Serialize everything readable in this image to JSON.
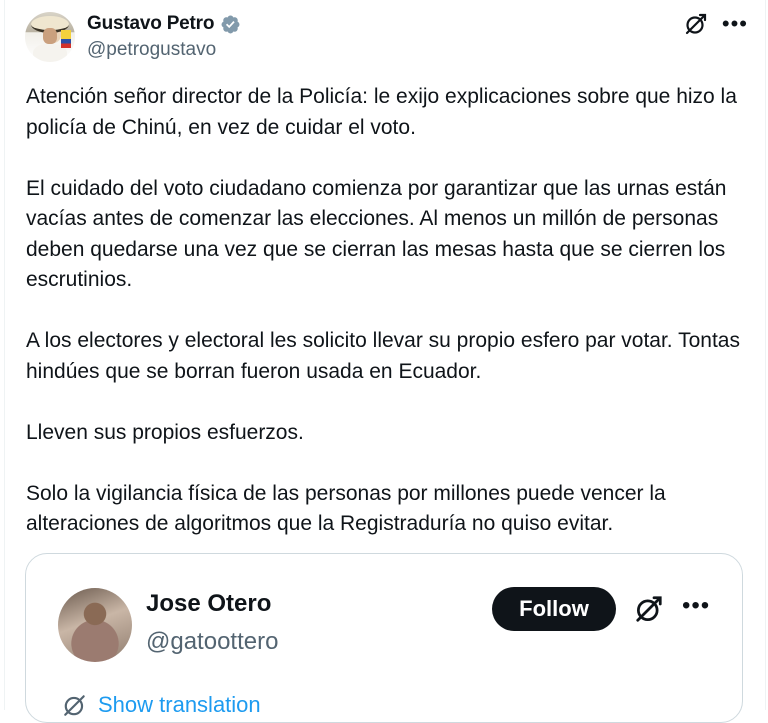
{
  "tweet": {
    "author": {
      "display_name": "Gustavo Petro",
      "handle": "@petrogustavo",
      "verified": true
    },
    "paragraphs": [
      "Atención señor director de la Policía: le exijo explicaciones sobre que hizo la policía de Chinú, en vez de cuidar el voto.",
      "El cuidado del voto ciudadano comienza por garantizar que las urnas están vacías antes de comenzar las elecciones. Al menos un millón de personas deben quedarse una vez que se cierran las mesas hasta que se cierren los escrutinios.",
      "A los electores y electoral les solicito llevar su propio esfero par votar. Tontas hindúes que se borran fueron usada en Ecuador.",
      "Lleven sus propios esfuerzos.",
      "Solo la vigilancia física de las personas por millones puede vencer la alteraciones de algoritmos que la Registraduría no quiso evitar."
    ]
  },
  "quoted": {
    "display_name": "Jose Otero",
    "handle": "@gatoottero",
    "follow_label": "Follow",
    "show_translation_label": "Show translation"
  },
  "icons": {
    "verified": "verified-badge-icon",
    "grok": "grok-icon",
    "more": "more-icon",
    "translate": "translate-icon"
  },
  "colors": {
    "text": "#0f1419",
    "secondary": "#536471",
    "link": "#1d9bf0",
    "border": "#cfd9de",
    "verified_badge": "#829aab"
  }
}
